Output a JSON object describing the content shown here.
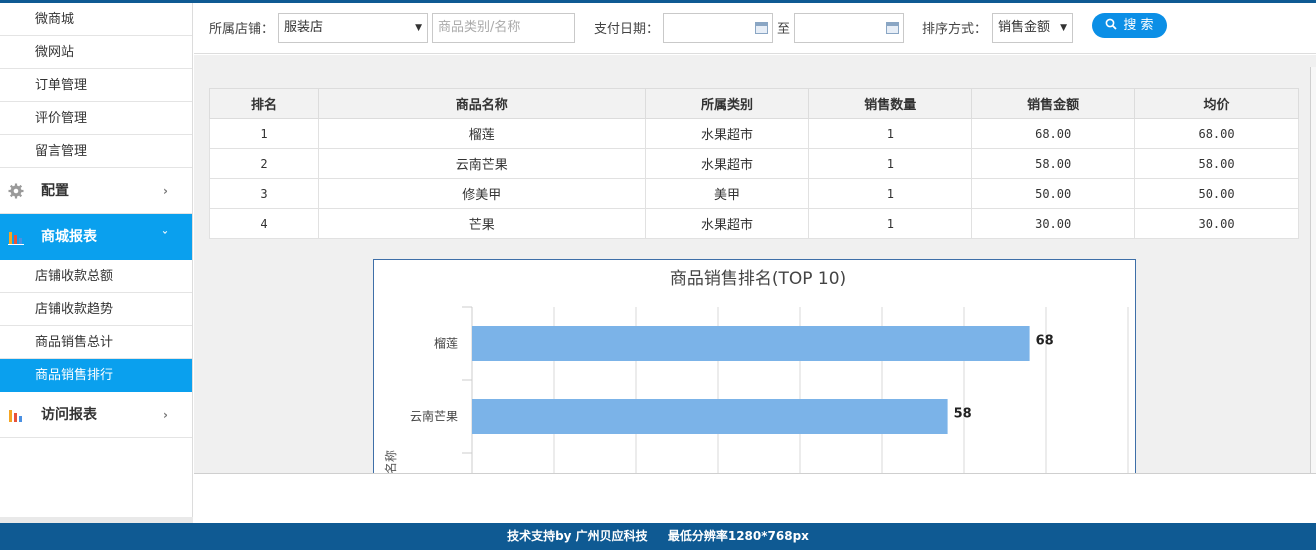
{
  "sidebar": {
    "items_top": [
      {
        "label": "微商城"
      },
      {
        "label": "微网站"
      },
      {
        "label": "订单管理"
      },
      {
        "label": "评价管理"
      },
      {
        "label": "留言管理"
      }
    ],
    "group_config": {
      "label": "配置",
      "icon": "gear-icon",
      "arrow": "›"
    },
    "group_reports": {
      "label": "商城报表",
      "icon": "bar-chart-icon",
      "arrow": "ˇ"
    },
    "items_reports": [
      {
        "label": "店铺收款总额"
      },
      {
        "label": "店铺收款趋势"
      },
      {
        "label": "商品销售总计"
      },
      {
        "label": "商品销售排行"
      }
    ],
    "group_visits": {
      "label": "访问报表",
      "icon": "bar-chart-icon",
      "arrow": "›"
    },
    "active_item": "商品销售排行",
    "accent_color": "#0aa0ee"
  },
  "filters": {
    "store_label": "所属店铺：",
    "store_value": "服装店",
    "category_placeholder": "商品类别/名称",
    "date_label": "支付日期：",
    "date_from": "",
    "date_to_label": "至",
    "date_to": "",
    "sort_label": "排序方式：",
    "sort_value": "销售金额",
    "search_label": "搜 索"
  },
  "table": {
    "headers": [
      "排名",
      "商品名称",
      "所属类别",
      "销售数量",
      "销售金额",
      "均价"
    ],
    "rows": [
      [
        "1",
        "榴莲",
        "水果超市",
        "1",
        "68.00",
        "68.00"
      ],
      [
        "2",
        "云南芒果",
        "水果超市",
        "1",
        "58.00",
        "58.00"
      ],
      [
        "3",
        "修美甲",
        "美甲",
        "1",
        "50.00",
        "50.00"
      ],
      [
        "4",
        "芒果",
        "水果超市",
        "1",
        "30.00",
        "30.00"
      ]
    ]
  },
  "chart_data": {
    "type": "bar",
    "orientation": "horizontal",
    "title": "商品销售排名(TOP 10)",
    "ylabel": "商品名称",
    "categories": [
      "榴莲",
      "云南芒果"
    ],
    "values": [
      68,
      58
    ],
    "value_labels": [
      "68",
      "58"
    ],
    "xlim": [
      0,
      80
    ],
    "grid": true,
    "bar_color": "#7bb3e8"
  },
  "footer": {
    "support": "技术支持by 广州贝应科技",
    "resolution": "最低分辨率1280*768px"
  }
}
